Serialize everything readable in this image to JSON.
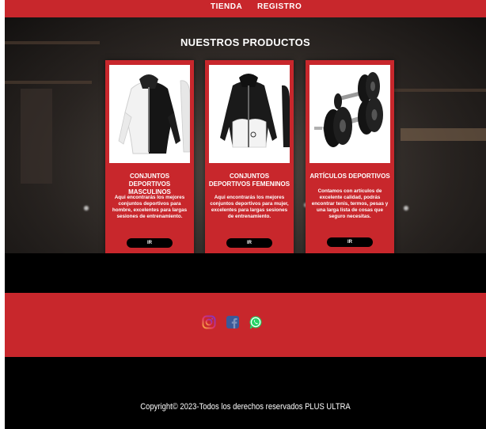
{
  "nav": {
    "items": [
      "TIENDA",
      "REGISTRO"
    ]
  },
  "products": {
    "title": "NUESTROS PRODUCTOS",
    "cards": [
      {
        "title": "CONJUNTOS DEPORTIVOS MASCULINOS",
        "description": "Aqui encontrarás los mejores conjuntos deportivos para hombre, excelentes para largas sesiones de entrenamiento.",
        "button": "IR",
        "image_icon": "mens-jacket-icon"
      },
      {
        "title": "CONJUNTOS DEPORTIVOS FEMENINOS",
        "description": "Aqui encontrarás los mejores conjuntos deportivos para mujer, excelentes para largas sesiones de entrenamiento.",
        "button": "IR",
        "image_icon": "womens-jacket-icon"
      },
      {
        "title": "ARTÍCULOS DEPORTIVOS",
        "description": "Contamos con artículos de excelente calidad, podrás encontrar tenis, termos, pesas y una larga lista de cosas que seguro necesitas.",
        "button": "IR",
        "image_icon": "dumbbells-icon"
      }
    ]
  },
  "footer": {
    "social": [
      "instagram-icon",
      "facebook-icon",
      "whatsapp-icon"
    ],
    "copyright": "Copyright© 2023-Todos los derechos reservados PLUS ULTRA"
  },
  "colors": {
    "brand_red": "#c8272c",
    "black": "#000000",
    "white": "#ffffff"
  }
}
